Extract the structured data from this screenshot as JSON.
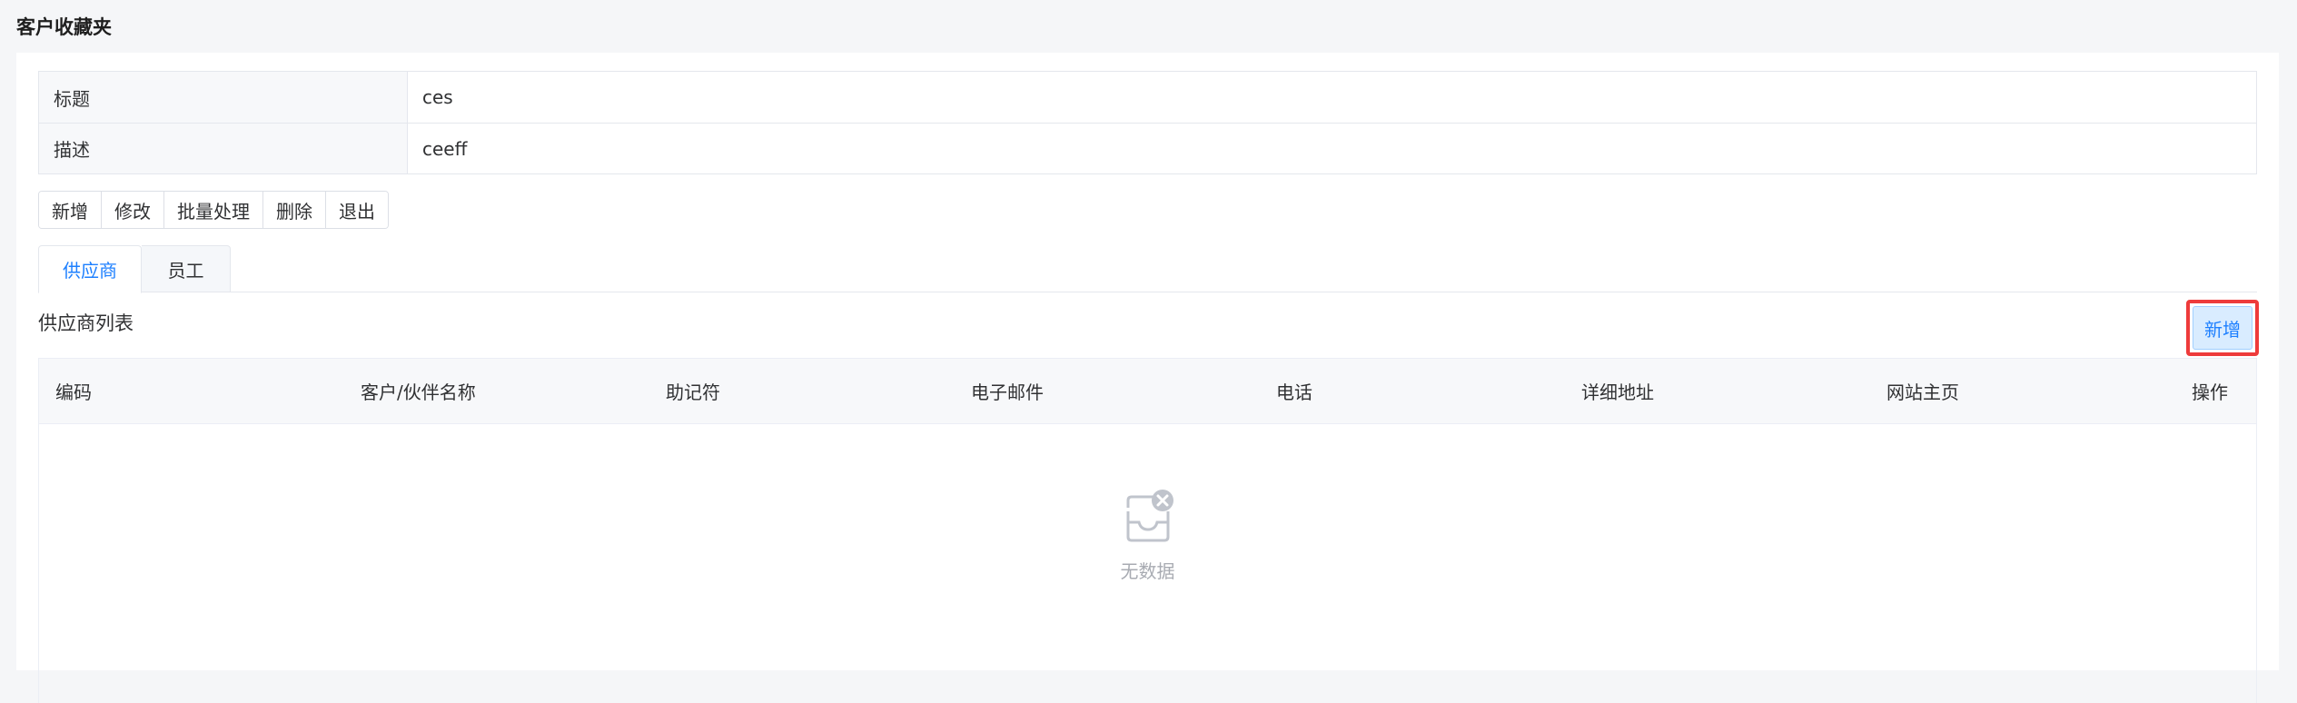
{
  "page": {
    "title": "客户收藏夹"
  },
  "details": [
    {
      "label": "标题",
      "value": "ces"
    },
    {
      "label": "描述",
      "value": "ceeff"
    }
  ],
  "actions": [
    "新增",
    "修改",
    "批量处理",
    "删除",
    "退出"
  ],
  "tabs": [
    {
      "label": "供应商",
      "active": true
    },
    {
      "label": "员工",
      "active": false
    }
  ],
  "list": {
    "title": "供应商列表",
    "add_label": "新增",
    "columns": [
      "编码",
      "客户/伙伴名称",
      "助记符",
      "电子邮件",
      "电话",
      "详细地址",
      "网站主页",
      "操作"
    ],
    "rows": [],
    "empty_text": "无数据",
    "empty_icon": "empty-inbox-icon"
  },
  "colors": {
    "accent": "#1e80ff",
    "highlight": "#ee3b3b"
  }
}
